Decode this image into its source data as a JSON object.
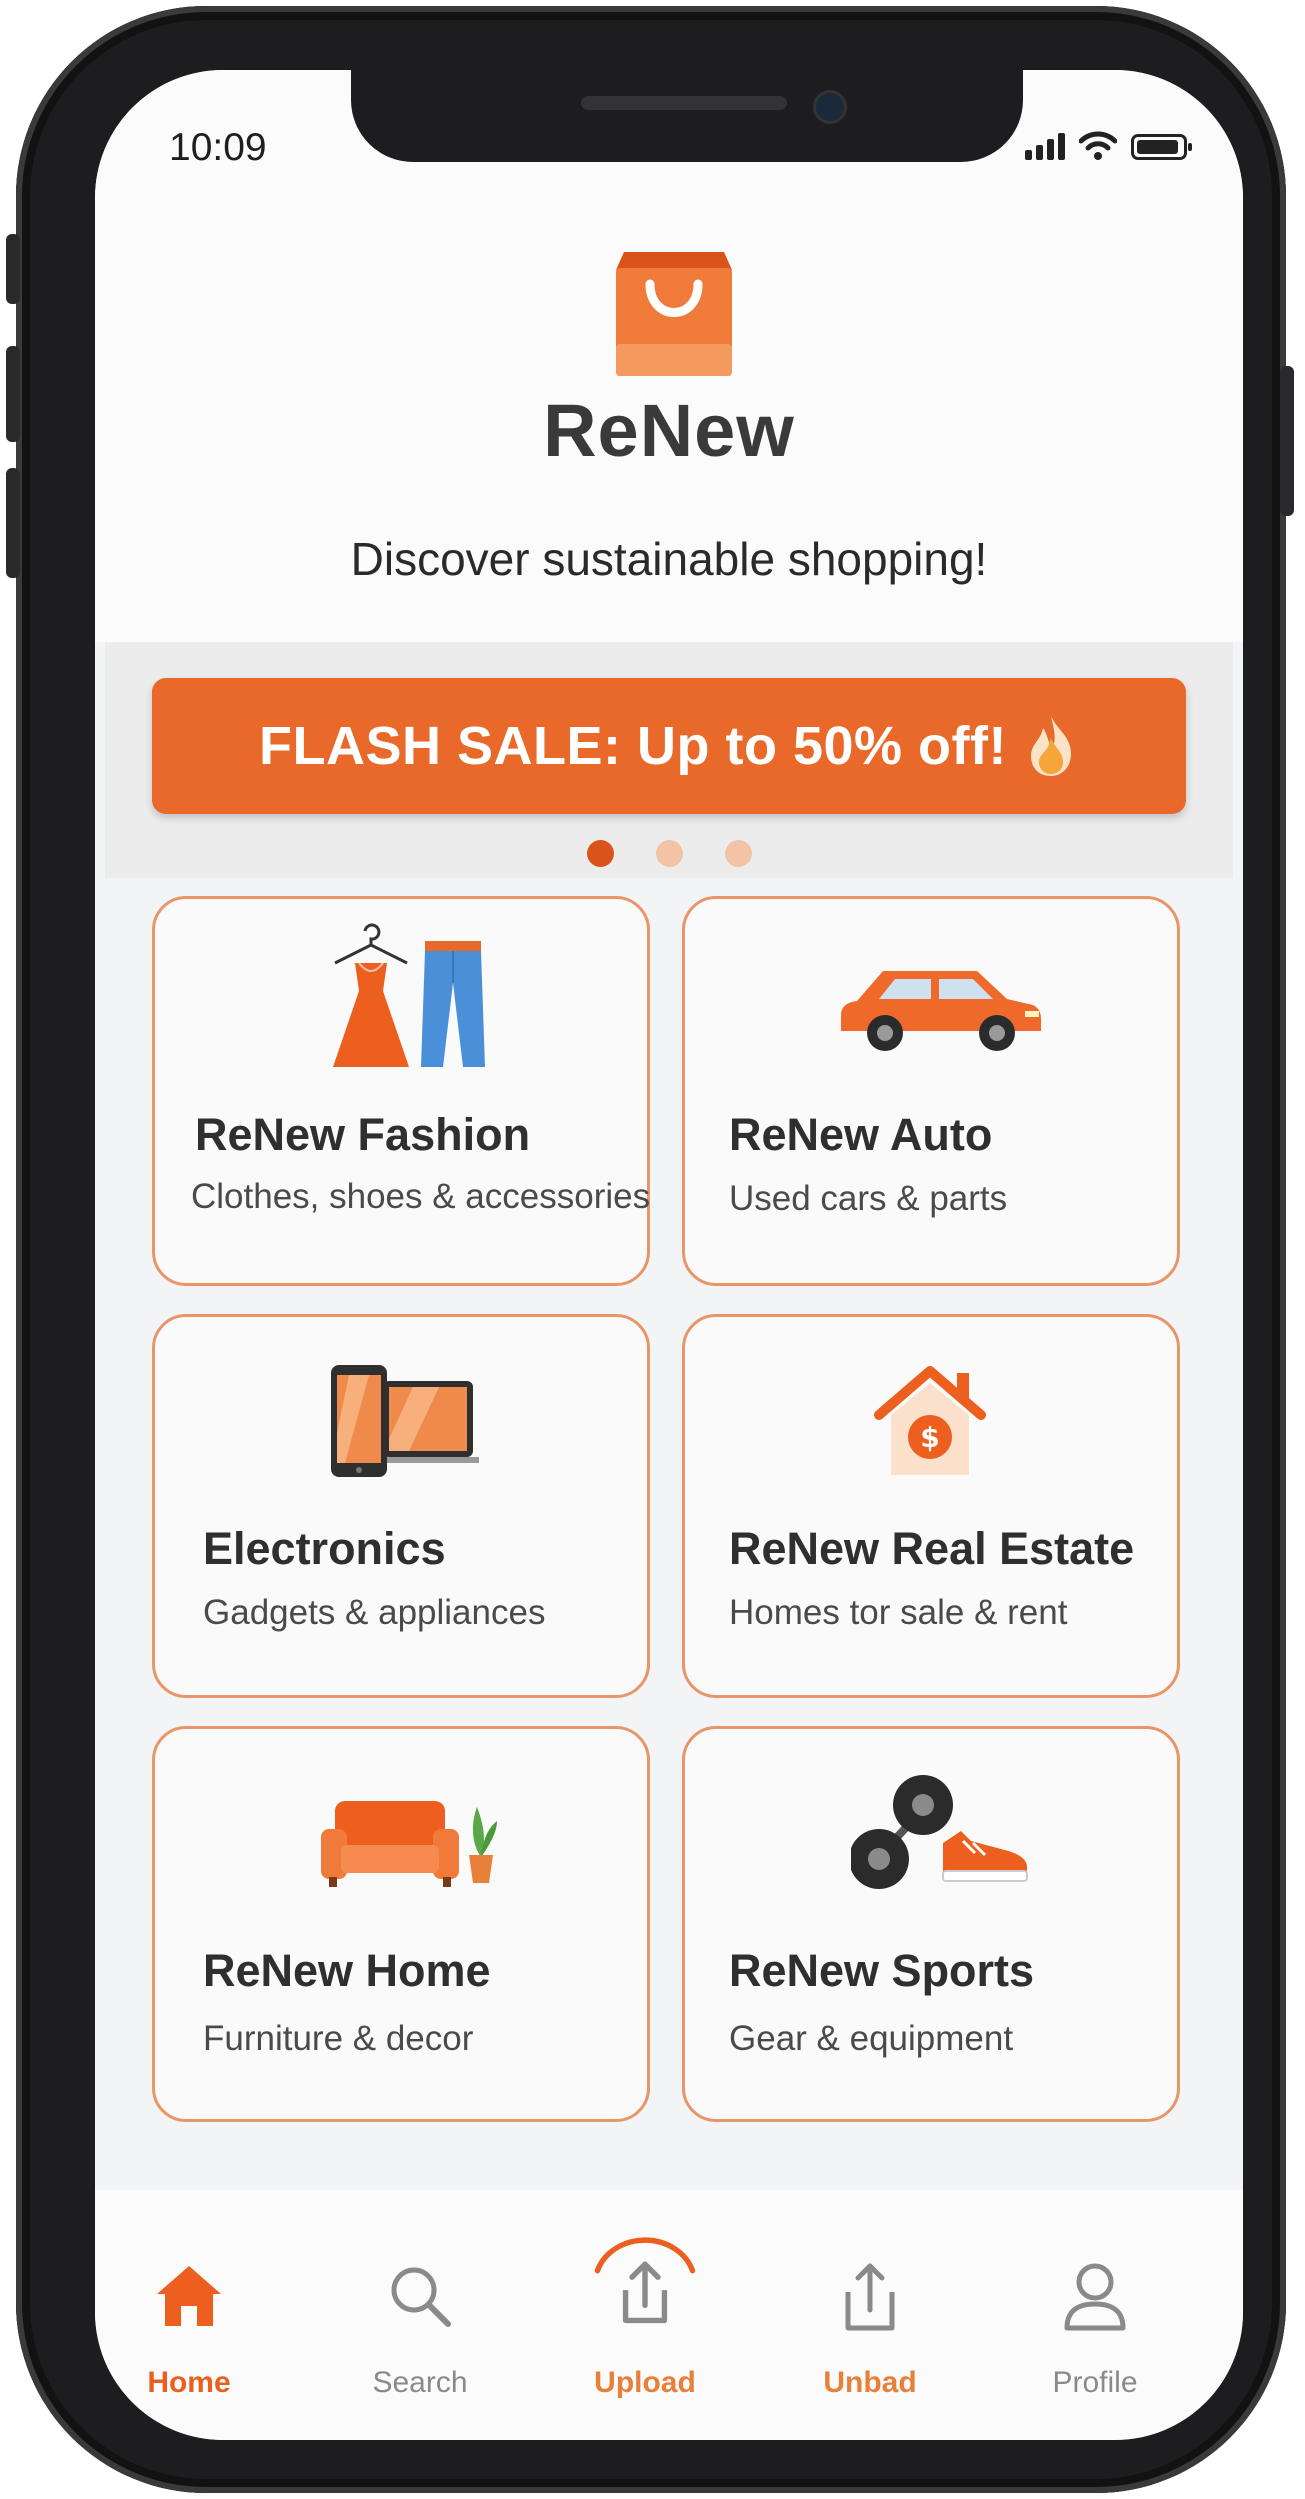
{
  "status_bar": {
    "time": "10:09"
  },
  "header": {
    "brand": "ReNew",
    "tagline": "Discover sustainable shopping!"
  },
  "banner": {
    "text": "FLASH SALE: Up to 50% off!",
    "icon": "fire-icon",
    "slides": 3,
    "active_slide": 1
  },
  "categories": [
    {
      "title": "ReNew Fashion",
      "subtitle": "Clothes, shoes & accessories",
      "icon": "clothing-icon"
    },
    {
      "title": "ReNew Auto",
      "subtitle": "Used cars & parts",
      "icon": "car-icon"
    },
    {
      "title": "Electronics",
      "subtitle": "Gadgets & appliances",
      "icon": "devices-icon"
    },
    {
      "title": "ReNew Real Estate",
      "subtitle": "Homes tor sale & rent",
      "icon": "house-dollar-icon"
    },
    {
      "title": "ReNew Home",
      "subtitle": "Furniture & decor",
      "icon": "sofa-plant-icon"
    },
    {
      "title": "ReNew Sports",
      "subtitle": "Gear & equipment",
      "icon": "dumbbell-sneaker-icon"
    }
  ],
  "tab_bar": [
    {
      "label": "Home",
      "icon": "home-icon",
      "active": true
    },
    {
      "label": "Search",
      "icon": "search-icon",
      "active": false
    },
    {
      "label": "Upload",
      "icon": "upload-icon",
      "active": false
    },
    {
      "label": "Unbad",
      "icon": "share-icon",
      "active": false
    },
    {
      "label": "Profile",
      "icon": "profile-icon",
      "active": false
    }
  ],
  "colors": {
    "accent": "#e8692a",
    "accent_light": "#f3c3a5",
    "card_border": "#e8956a",
    "text_dark": "#2f2f2f",
    "tab_inactive": "#8a8a8a"
  }
}
